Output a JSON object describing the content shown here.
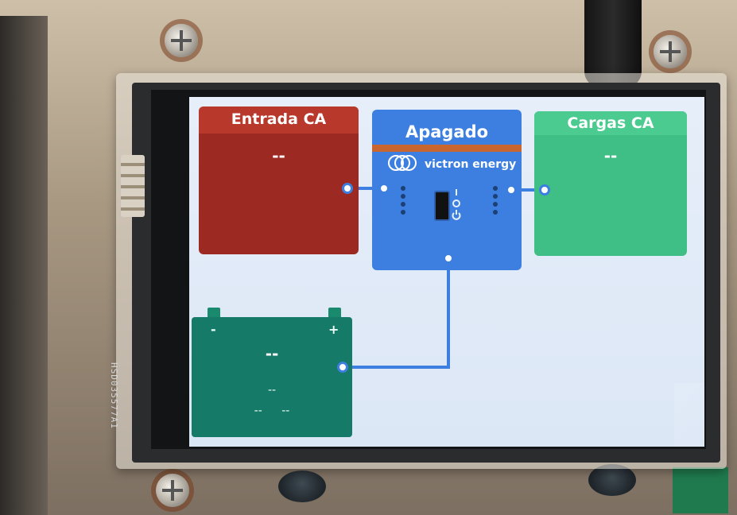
{
  "device": {
    "pcb_label": "HSD035577A1"
  },
  "screen": {
    "ac_input": {
      "title": "Entrada CA",
      "value": "--"
    },
    "inverter": {
      "state": "Apagado",
      "brand": "victron energy"
    },
    "ac_loads": {
      "title": "Cargas CA",
      "value": "--"
    },
    "battery": {
      "minus_label": "-",
      "plus_label": "+",
      "voltage": "--",
      "soc": "--",
      "current": "--",
      "power": "--"
    }
  },
  "colors": {
    "ac_input": "#9c2a22",
    "inverter": "#3d7fe0",
    "ac_loads": "#3fbf85",
    "battery": "#157a67",
    "wire": "#3d7fe0"
  }
}
